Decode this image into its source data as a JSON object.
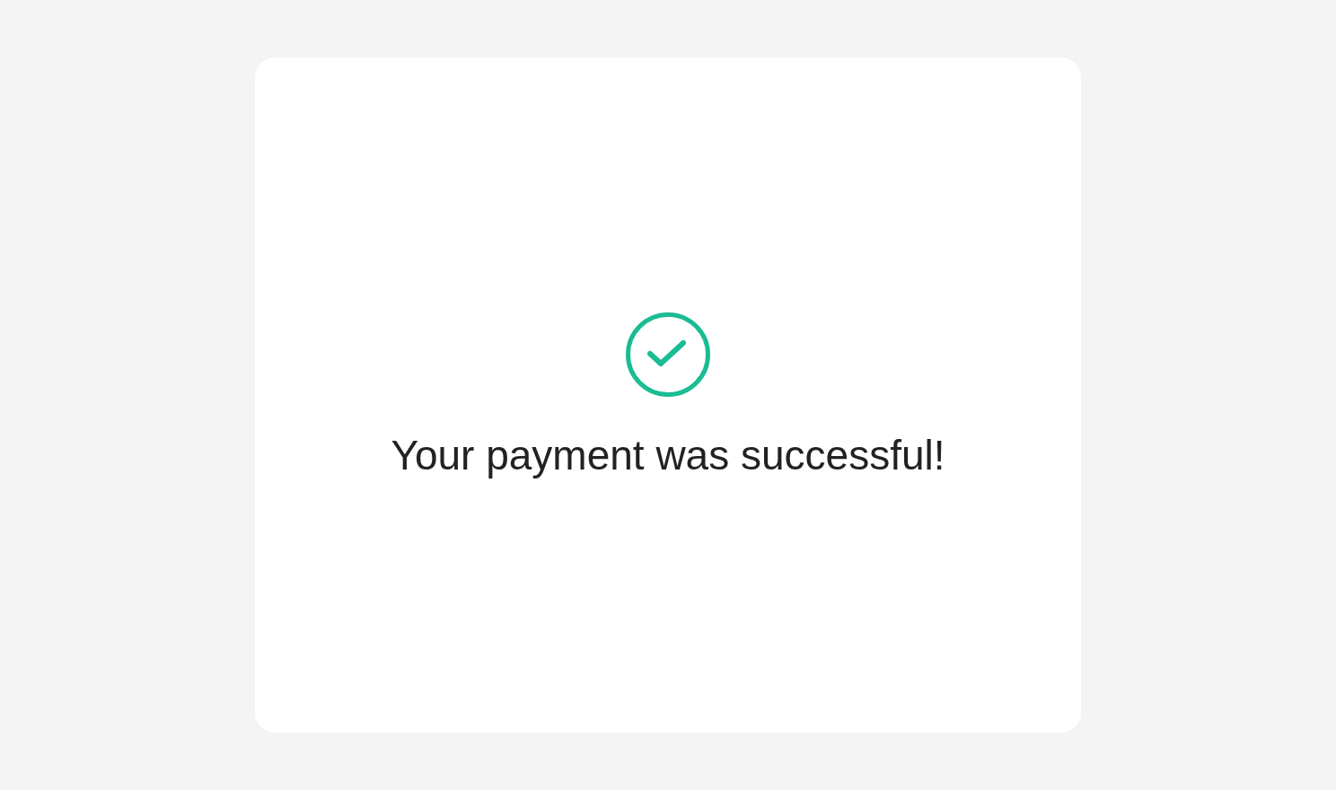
{
  "status": {
    "kind": "success",
    "message": "Your payment was successful!"
  }
}
